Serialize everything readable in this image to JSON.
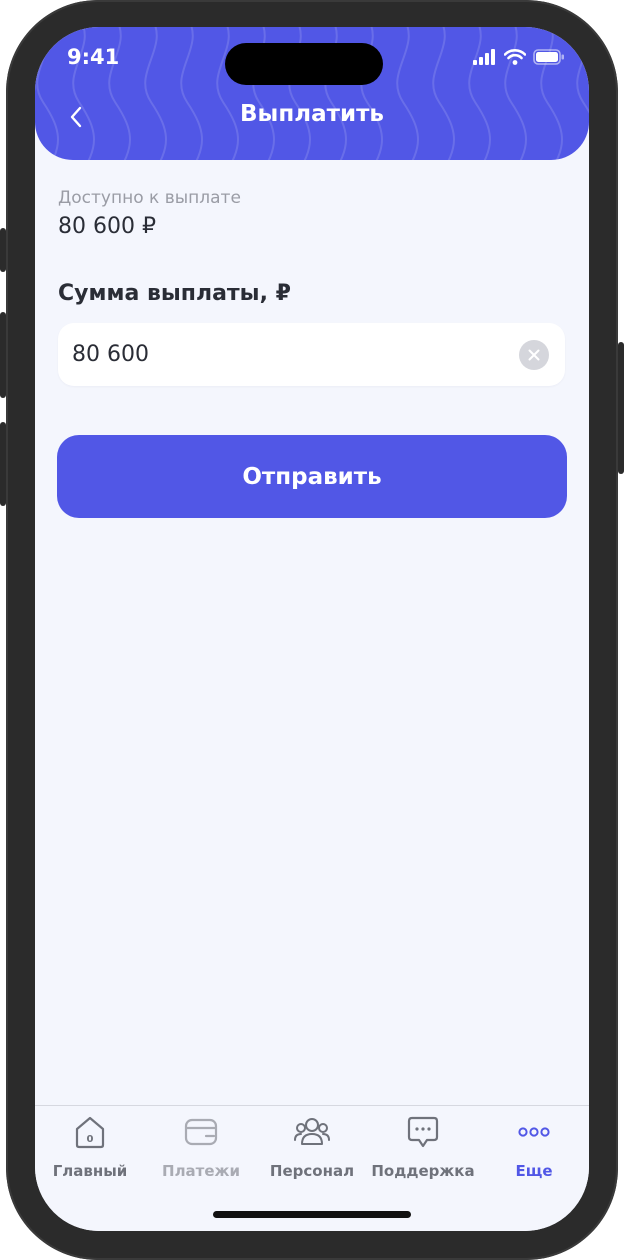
{
  "status_bar": {
    "time": "9:41"
  },
  "header": {
    "title": "Выплатить"
  },
  "available": {
    "label": "Доступно к выплате",
    "value": "80 600 ₽"
  },
  "amount": {
    "label": "Сумма выплаты, ₽",
    "value": "80 600"
  },
  "submit": {
    "label": "Отправить"
  },
  "tabs": [
    {
      "label": "Главный",
      "icon": "home-icon"
    },
    {
      "label": "Платежи",
      "icon": "wallet-icon"
    },
    {
      "label": "Персонал",
      "icon": "people-icon"
    },
    {
      "label": "Поддержка",
      "icon": "chat-icon"
    },
    {
      "label": "Еще",
      "icon": "more-dots-icon"
    }
  ],
  "colors": {
    "accent": "#5157E6",
    "background": "#F4F6FD",
    "text": "#2a2d36",
    "muted": "#9a9ca5"
  }
}
